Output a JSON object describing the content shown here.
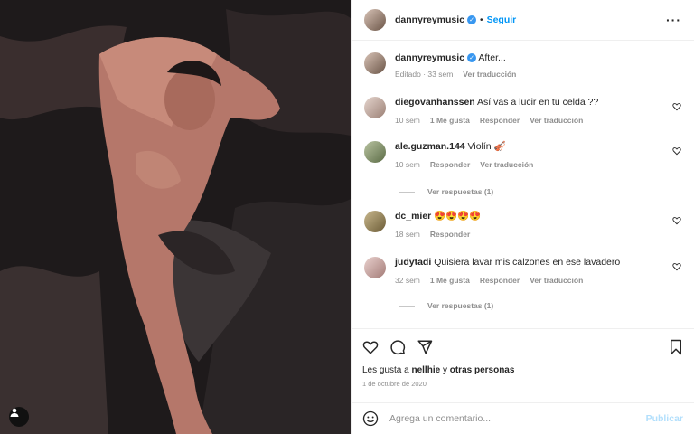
{
  "post": {
    "author": "dannyreymusic",
    "follow_label": "Seguir",
    "caption": "After...",
    "caption_meta": {
      "edited": "Editado",
      "time": "33 sem",
      "translate": "Ver traducción"
    }
  },
  "comments": [
    {
      "user": "diegovanhanssen",
      "text": "Así vas a lucir en tu celda ??",
      "time": "10 sem",
      "likes": "1 Me gusta",
      "reply": "Responder",
      "translate": "Ver traducción"
    },
    {
      "user": "ale.guzman.144",
      "text": "Violín 🎻",
      "time": "10 sem",
      "reply": "Responder",
      "translate": "Ver traducción",
      "replies": "Ver respuestas (1)"
    },
    {
      "user": "dc_mier",
      "text": "😍😍😍😍",
      "time": "18 sem",
      "reply": "Responder"
    },
    {
      "user": "judytadi",
      "text": "Quisiera lavar mis calzones en ese lavadero",
      "time": "32 sem",
      "likes": "1 Me gusta",
      "reply": "Responder",
      "translate": "Ver traducción",
      "replies": "Ver respuestas (1)"
    }
  ],
  "likes": {
    "prefix": "Les gusta a ",
    "user": "nellhie",
    "middle": " y ",
    "others": "otras personas"
  },
  "date": "1 de octubre de 2020",
  "add_comment": {
    "placeholder": "Agrega un comentario...",
    "publish": "Publicar"
  },
  "colors": {
    "accent": "#0095f6",
    "muted": "#8e8e8e",
    "verified": "#3897f0"
  }
}
